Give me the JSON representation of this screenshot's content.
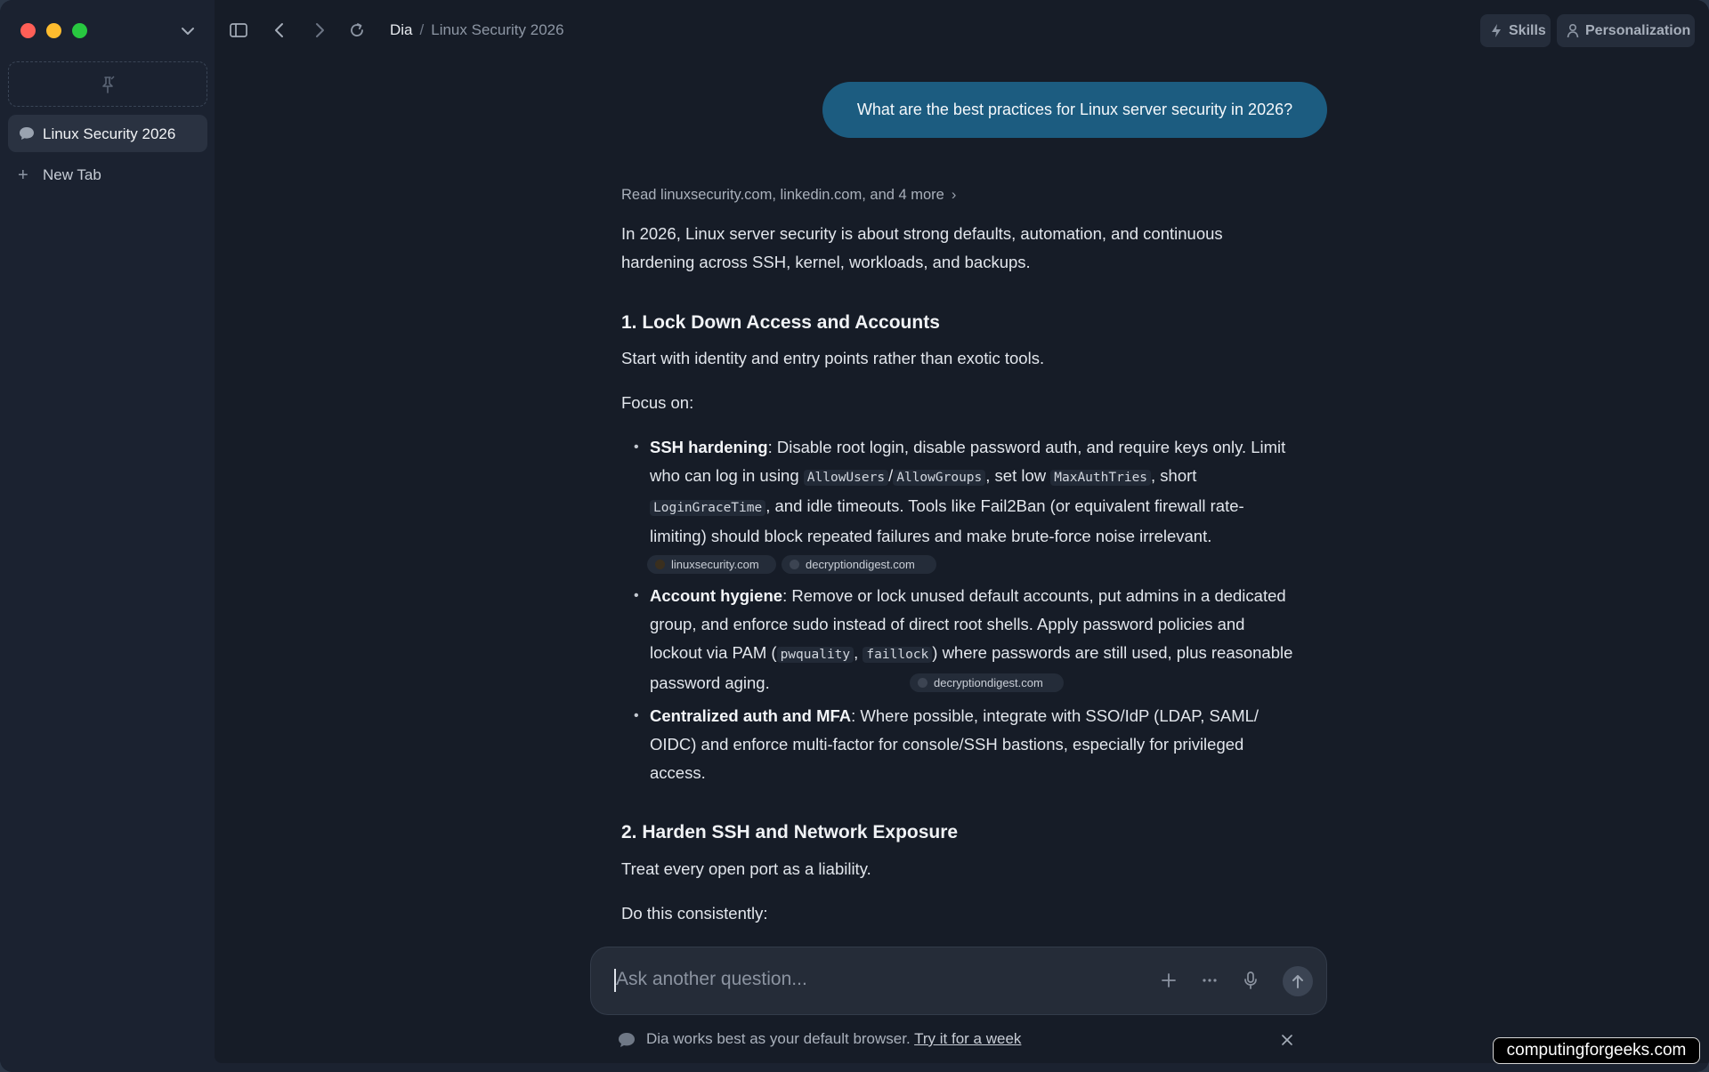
{
  "window": {
    "sidebar": {
      "tabs": [
        {
          "label": "Linux Security 2026",
          "icon": "chat-bubble-icon",
          "active": true
        }
      ],
      "new_tab_label": "New Tab"
    },
    "breadcrumb": {
      "app": "Dia",
      "separator": "/",
      "page": "Linux Security 2026"
    },
    "top_buttons": {
      "skills": "Skills",
      "personalization": "Personalization"
    }
  },
  "chat": {
    "user_message": "What are the best practices for Linux server security in 2026?",
    "sources_summary": "Read linuxsecurity.com, linkedin.com, and 4 more",
    "intro": "In 2026, Linux server security is about strong defaults, automation, and continuous hardening across SSH, kernel, workloads, and backups.",
    "section1": {
      "title": "1. Lock Down Access and Accounts",
      "lead": "Start with identity and entry points rather than exotic tools.",
      "focus": "Focus on:",
      "items": [
        {
          "title": "SSH hardening",
          "t1": ": Disable root login, disable password auth, and require keys only. Limit who can log in using ",
          "c1": "AllowUsers",
          "t2": "/",
          "c2": "AllowGroups",
          "t3": ", set low ",
          "c3": "MaxAuthTries",
          "t4": ", short ",
          "c4": "LoginGraceTime",
          "t5": ", and idle timeouts. Tools like Fail2Ban (or equivalent firewall rate-limiting) should block repeated failures and make brute-force noise irrelevant.",
          "sources": [
            "linuxsecurity.com",
            "decryptiondigest.com"
          ]
        },
        {
          "title": "Account hygiene",
          "t1": ": Remove or lock unused default accounts, put admins in a dedicated group, and enforce sudo instead of direct root shells. Apply password policies and lockout via PAM (",
          "c1": "pwquality",
          "t2": ", ",
          "c2": "faillock",
          "t3": ") where passwords are still used, plus reasonable password aging.",
          "sources": [
            "decryptiondigest.com"
          ]
        },
        {
          "title": "Centralized auth and MFA",
          "t1": ": Where possible, integrate with SSO/IdP (LDAP, SAML/ OIDC) and enforce multi-factor for console/SSH bastions, especially for privileged access."
        }
      ]
    },
    "section2": {
      "title": "2. Harden SSH and Network Exposure",
      "lead": "Treat every open port as a liability.",
      "next": "Do this consistently:"
    }
  },
  "composer": {
    "placeholder": "Ask another question..."
  },
  "banner": {
    "text": "Dia works best as your default browser.",
    "link": "Try it for a week"
  },
  "watermark": "computingforgeeks.com",
  "colors": {
    "user_bubble": "#1c5c80",
    "background": "#161c27",
    "sidebar": "#1b2230"
  }
}
